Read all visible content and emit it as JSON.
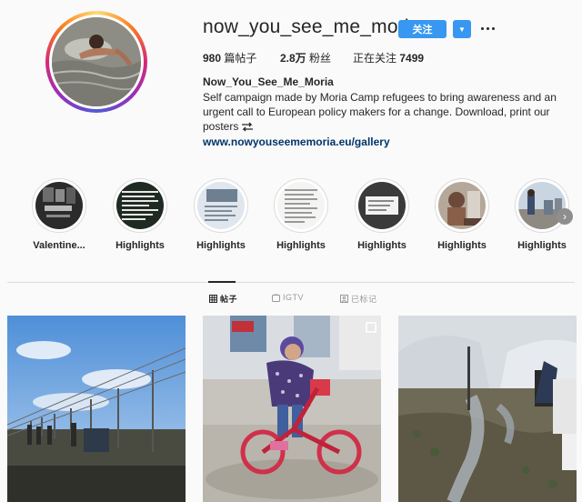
{
  "profile": {
    "username": "now_you_see_me_moria",
    "follow_label": "关注",
    "dropdown_icon": "▼",
    "posts_count": "980",
    "posts_label": " 篇帖子",
    "followers_count": "2.8万",
    "followers_label": " 粉丝",
    "following_label": "正在关注 ",
    "following_count": "7499",
    "full_name": "Now_You_See_Me_Moria",
    "bio_lines": [
      "Self campaign made by Moria Camp refugees to bring awareness and an",
      "urgent call to European policy makers for a change. Download, print our",
      "posters"
    ],
    "website": "www.nowyouseememoria.eu/gallery"
  },
  "highlights": [
    {
      "label": "Valentine..."
    },
    {
      "label": "Highlights"
    },
    {
      "label": "Highlights"
    },
    {
      "label": "Highlights"
    },
    {
      "label": "Highlights"
    },
    {
      "label": "Highlights"
    },
    {
      "label": "Highlights"
    }
  ],
  "highlights_next_icon": "›",
  "tabs": [
    {
      "label": "帖子",
      "icon": "grid-icon",
      "active": true
    },
    {
      "label": "IGTV",
      "icon": "tv-icon",
      "active": false
    },
    {
      "label": "已标记",
      "icon": "tag-icon",
      "active": false
    }
  ],
  "colors": {
    "accent": "#3897f0",
    "link": "#003569",
    "text": "#262626",
    "muted": "#999999",
    "border": "#dbdbdb"
  },
  "posts": [
    {
      "subject": "border fence with people walking"
    },
    {
      "subject": "child riding a red bicycle"
    },
    {
      "subject": "muddy camp with tents"
    }
  ]
}
